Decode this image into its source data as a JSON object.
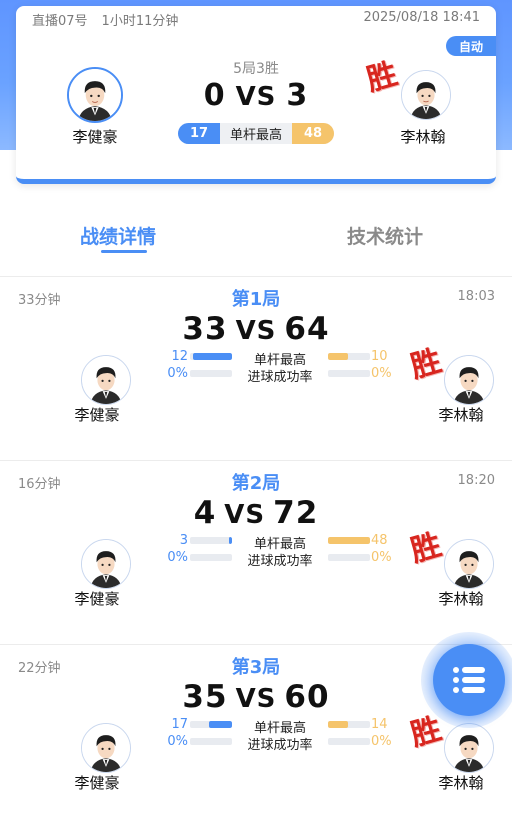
{
  "summary": {
    "room": "直播07号",
    "duration": "1小时11分钟",
    "datetime": "2025/08/18 18:41",
    "auto_badge": "自动",
    "format": "5局3胜",
    "score_left": "0",
    "vs": "VS",
    "score_right": "3",
    "stat_left": "17",
    "stat_label": "单杆最高",
    "stat_right": "48",
    "player_left": "李健豪",
    "player_right": "李林翰",
    "win_mark": "胜"
  },
  "tabs": {
    "active": "战绩详情",
    "inactive": "技术统计"
  },
  "games": [
    {
      "duration": "33分钟",
      "title": "第1局",
      "time": "18:03",
      "score_left": "33",
      "vs": "VS",
      "score_right": "64",
      "stats": [
        {
          "label": "单杆最高",
          "left": "12",
          "right": "10",
          "left_fill": 0.92,
          "right_fill": 0.48
        },
        {
          "label": "进球成功率",
          "left": "0%",
          "right": "0%",
          "left_fill": 0,
          "right_fill": 0
        }
      ],
      "player_left": "李健豪",
      "player_right": "李林翰",
      "win_mark": "胜"
    },
    {
      "duration": "16分钟",
      "title": "第2局",
      "time": "18:20",
      "score_left": "4",
      "vs": "VS",
      "score_right": "72",
      "stats": [
        {
          "label": "单杆最高",
          "left": "3",
          "right": "48",
          "left_fill": 0.06,
          "right_fill": 1.0
        },
        {
          "label": "进球成功率",
          "left": "0%",
          "right": "0%",
          "left_fill": 0,
          "right_fill": 0
        }
      ],
      "player_left": "李健豪",
      "player_right": "李林翰",
      "win_mark": "胜"
    },
    {
      "duration": "22分钟",
      "title": "第3局",
      "time": "",
      "score_left": "35",
      "vs": "VS",
      "score_right": "60",
      "stats": [
        {
          "label": "单杆最高",
          "left": "17",
          "right": "14",
          "left_fill": 0.55,
          "right_fill": 0.48
        },
        {
          "label": "进球成功率",
          "left": "0%",
          "right": "0%",
          "left_fill": 0,
          "right_fill": 0
        }
      ],
      "player_left": "李健豪",
      "player_right": "李林翰",
      "win_mark": "胜"
    }
  ],
  "fab": {
    "icon": "list-menu-icon"
  },
  "colors": {
    "primary": "#4a8ef5",
    "secondary": "#f5c46b",
    "win": "#d8261f"
  }
}
